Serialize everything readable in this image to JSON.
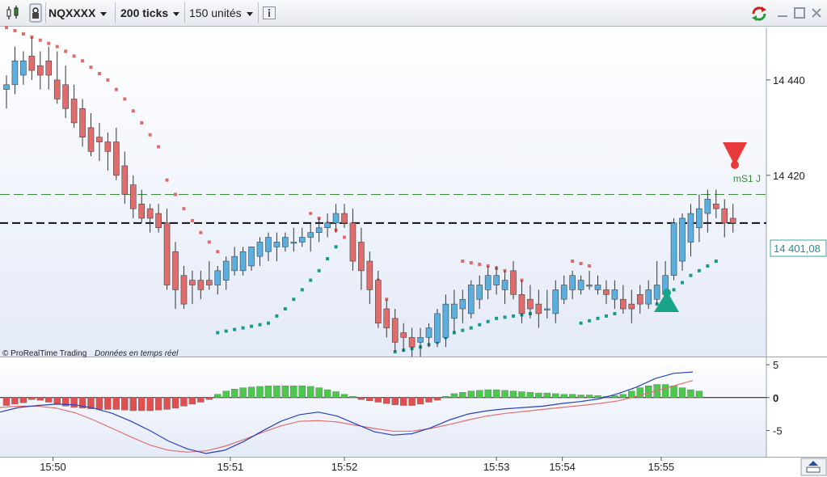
{
  "toolbar": {
    "symbol": "NQXXXX",
    "interval": "200 ticks",
    "units": "150 unités",
    "icons": [
      "candlestick-icon",
      "lock-icon",
      "info-icon",
      "refresh-icon",
      "minimize-icon",
      "maximize-icon",
      "close-icon"
    ]
  },
  "chart": {
    "copyright": "© ProRealTime Trading",
    "realtime": "Données en temps réel",
    "level_label": "mS1 J",
    "last_price": "14 401,08",
    "price_ticks": [
      "14 440",
      "14 420"
    ],
    "osc_ticks": [
      "5",
      "0",
      "-5"
    ],
    "time_ticks": [
      "15:50",
      "15:51",
      "15:52",
      "15:53",
      "15:54",
      "15:55"
    ]
  },
  "colors": {
    "up": "#5aaee0",
    "down": "#e06c6c",
    "sar_red": "#e06c6c",
    "sar_teal": "#1a9a8a",
    "hist_up": "#4cc94c",
    "hist_down": "#e05050",
    "blue_line": "#2a3fbf",
    "red_line": "#e07070",
    "green_level": "#3a8a3a",
    "price_bg": "#eef2fb"
  },
  "chart_data": {
    "type": "candlestick",
    "time_ticks": [
      "15:50",
      "15:51",
      "15:52",
      "15:53",
      "15:54",
      "15:55"
    ],
    "ylim": [
      14382,
      14451
    ],
    "level_mS1J": 14416,
    "pivot_level": 14410,
    "last_price": 14401.08,
    "candles": [
      [
        14438,
        14441,
        14434,
        14439
      ],
      [
        14439,
        14447,
        14437,
        14444
      ],
      [
        14441,
        14446,
        14439,
        14444
      ],
      [
        14445,
        14449,
        14440,
        14442
      ],
      [
        14443,
        14446,
        14438,
        14441
      ],
      [
        14444,
        14447,
        14438,
        14441
      ],
      [
        14440,
        14446,
        14435,
        14436
      ],
      [
        14439,
        14443,
        14432,
        14434
      ],
      [
        14436,
        14439,
        14430,
        14431
      ],
      [
        14434,
        14436,
        14426,
        14428
      ],
      [
        14430,
        14433,
        14424,
        14425
      ],
      [
        14428,
        14431,
        14423,
        14427
      ],
      [
        14427,
        14429,
        14421,
        14425
      ],
      [
        14427,
        14430,
        14419,
        14420
      ],
      [
        14422,
        14425,
        14414,
        14416
      ],
      [
        14418,
        14420,
        14411,
        14413
      ],
      [
        14414,
        14417,
        14410,
        14411
      ],
      [
        14413,
        14414,
        14408,
        14411
      ],
      [
        14412,
        14414,
        14408,
        14409
      ],
      [
        14410,
        14413,
        14396,
        14397
      ],
      [
        14404,
        14406,
        14392,
        14396
      ],
      [
        14399,
        14401,
        14392,
        14393
      ],
      [
        14398,
        14400,
        14393,
        14397
      ],
      [
        14398,
        14400,
        14394,
        14396
      ],
      [
        14398,
        14402,
        14396,
        14397
      ],
      [
        14397,
        14401,
        14395,
        14400
      ],
      [
        14398,
        14403,
        14396,
        14402
      ],
      [
        14400,
        14405,
        14399,
        14403
      ],
      [
        14400,
        14405,
        14399,
        14404
      ],
      [
        14401,
        14405,
        14400,
        14405
      ],
      [
        14403,
        14407,
        14401,
        14406
      ],
      [
        14404,
        14408,
        14402,
        14407
      ],
      [
        14405,
        14408,
        14402,
        14406
      ],
      [
        14405,
        14408,
        14404,
        14407
      ],
      [
        14406,
        14409,
        14404,
        14406
      ],
      [
        14406,
        14409,
        14405,
        14407
      ],
      [
        14407,
        14410,
        14404,
        14408
      ],
      [
        14408,
        14411,
        14406,
        14409
      ],
      [
        14409,
        14412,
        14407,
        14410
      ],
      [
        14410,
        14414,
        14408,
        14412
      ],
      [
        14412,
        14414,
        14409,
        14410
      ],
      [
        14410,
        14413,
        14400,
        14402
      ],
      [
        14406,
        14409,
        14396,
        14400
      ],
      [
        14402,
        14404,
        14393,
        14396
      ],
      [
        14398,
        14400,
        14388,
        14389
      ],
      [
        14392,
        14394,
        14386,
        14388
      ],
      [
        14390,
        14392,
        14383,
        14385
      ],
      [
        14387,
        14389,
        14383,
        14386
      ],
      [
        14386,
        14388,
        14382,
        14384
      ],
      [
        14385,
        14388,
        14382,
        14386
      ],
      [
        14386,
        14389,
        14384,
        14388
      ],
      [
        14385,
        14392,
        14384,
        14391
      ],
      [
        14386,
        14395,
        14384,
        14393
      ],
      [
        14390,
        14396,
        14387,
        14393
      ],
      [
        14392,
        14396,
        14389,
        14394
      ],
      [
        14391,
        14398,
        14390,
        14397
      ],
      [
        14394,
        14399,
        14392,
        14397
      ],
      [
        14396,
        14401,
        14394,
        14399
      ],
      [
        14397,
        14401,
        14395,
        14399
      ],
      [
        14396,
        14400,
        14393,
        14398
      ],
      [
        14400,
        14402,
        14394,
        14395
      ],
      [
        14395,
        14398,
        14389,
        14391
      ],
      [
        14394,
        14397,
        14390,
        14392
      ],
      [
        14393,
        14396,
        14388,
        14391
      ],
      [
        14392,
        14396,
        14390,
        14392
      ],
      [
        14391,
        14398,
        14389,
        14396
      ],
      [
        14394,
        14399,
        14393,
        14397
      ],
      [
        14396,
        14400,
        14394,
        14399
      ],
      [
        14396,
        14399,
        14395,
        14398
      ],
      [
        14397,
        14400,
        14396,
        14397
      ],
      [
        14396,
        14399,
        14395,
        14397
      ],
      [
        14396,
        14398,
        14393,
        14395
      ],
      [
        14394,
        14398,
        14392,
        14396
      ],
      [
        14394,
        14397,
        14391,
        14392
      ],
      [
        14393,
        14396,
        14389,
        14392
      ],
      [
        14395,
        14397,
        14391,
        14393
      ],
      [
        14393,
        14398,
        14392,
        14396
      ],
      [
        14394,
        14402,
        14393,
        14397
      ],
      [
        14395,
        14402,
        14393,
        14399
      ],
      [
        14399,
        14411,
        14398,
        14410
      ],
      [
        14402,
        14412,
        14400,
        14411
      ],
      [
        14406,
        14414,
        14403,
        14412
      ],
      [
        14409,
        14416,
        14406,
        14413
      ],
      [
        14412,
        14417,
        14408,
        14415
      ],
      [
        14414,
        14417,
        14411,
        14413
      ],
      [
        14413,
        14415,
        14407,
        14410
      ],
      [
        14411,
        14414,
        14408,
        14410
      ]
    ],
    "series": [
      {
        "name": "sar_red",
        "points": [
          [
            0,
            14451
          ],
          [
            3,
            14449
          ],
          [
            6,
            14447
          ],
          [
            9,
            14444
          ],
          [
            12,
            14440
          ],
          [
            14,
            14436
          ],
          [
            16,
            14431
          ],
          [
            18,
            14426
          ],
          [
            19,
            14419
          ],
          [
            21,
            14413
          ],
          [
            23,
            14408
          ],
          [
            25,
            14404
          ],
          [
            36,
            14412
          ],
          [
            38,
            14410
          ],
          [
            40,
            14407
          ],
          [
            42,
            14402
          ],
          [
            44,
            14398
          ],
          [
            45,
            14394
          ],
          [
            54,
            14402
          ],
          [
            57,
            14401
          ],
          [
            59,
            14400
          ],
          [
            61,
            14398
          ],
          [
            67,
            14402
          ],
          [
            69,
            14401
          ]
        ]
      },
      {
        "name": "sar_teal",
        "points": [
          [
            25,
            14387
          ],
          [
            28,
            14388
          ],
          [
            31,
            14389
          ],
          [
            33,
            14392
          ],
          [
            35,
            14396
          ],
          [
            37,
            14400
          ],
          [
            39,
            14405
          ],
          [
            46,
            14383
          ],
          [
            49,
            14384
          ],
          [
            51,
            14385
          ],
          [
            53,
            14387
          ],
          [
            55,
            14388
          ],
          [
            58,
            14390
          ],
          [
            62,
            14391
          ],
          [
            68,
            14389
          ],
          [
            70,
            14390
          ],
          [
            72,
            14391
          ],
          [
            77,
            14393
          ],
          [
            79,
            14396
          ],
          [
            81,
            14399
          ],
          [
            84,
            14402
          ]
        ]
      }
    ],
    "oscillator": {
      "ylim": [
        -9,
        6
      ],
      "histogram": [
        -1.2,
        -1.0,
        -0.8,
        -0.3,
        -0.4,
        -0.7,
        -1.0,
        -1.3,
        -1.5,
        -1.6,
        -1.7,
        -1.8,
        -1.8,
        -1.8,
        -1.9,
        -2.0,
        -2.0,
        -2.0,
        -1.9,
        -1.8,
        -1.6,
        -1.3,
        -1.0,
        -0.7,
        -0.3,
        0.5,
        1.0,
        1.3,
        1.5,
        1.6,
        1.7,
        1.8,
        1.8,
        1.8,
        1.8,
        1.8,
        1.7,
        1.5,
        1.2,
        0.9,
        0.5,
        0.2,
        -0.3,
        -0.5,
        -0.7,
        -0.9,
        -1.1,
        -1.2,
        -1.2,
        -1.0,
        -0.7,
        -0.4,
        0.2,
        0.6,
        0.8,
        1.0,
        1.1,
        1.2,
        1.2,
        1.1,
        1.0,
        0.9,
        0.8,
        0.7,
        0.7,
        0.6,
        0.5,
        0.5,
        0.4,
        0.4,
        0.3,
        0.2,
        0.3,
        0.5,
        1.0,
        1.5,
        1.8,
        2.0,
        2.0,
        1.8,
        1.5,
        1.2,
        1.0
      ],
      "blue": [
        -2.2,
        -1.5,
        -1.2,
        -1.0,
        -1.1,
        -1.6,
        -2.4,
        -3.6,
        -5.0,
        -6.6,
        -7.8,
        -8.5,
        -8.0,
        -6.7,
        -5.1,
        -3.6,
        -2.6,
        -2.2,
        -2.8,
        -4.0,
        -5.2,
        -5.7,
        -5.5,
        -4.6,
        -3.4,
        -2.5,
        -2.0,
        -1.7,
        -1.5,
        -1.3,
        -0.9,
        -0.6,
        -0.2,
        0.6,
        1.6,
        2.9,
        3.7,
        3.9
      ],
      "red": [
        -1.5,
        -1.3,
        -1.3,
        -1.6,
        -2.3,
        -3.4,
        -4.7,
        -6.0,
        -7.2,
        -8.0,
        -8.3,
        -8.1,
        -7.4,
        -6.4,
        -5.3,
        -4.3,
        -3.6,
        -3.5,
        -3.7,
        -4.2,
        -4.7,
        -5.1,
        -5.1,
        -4.7,
        -4.1,
        -3.4,
        -2.8,
        -2.4,
        -2.1,
        -1.8,
        -1.5,
        -1.2,
        -0.9,
        -0.5,
        0.2,
        1.0,
        1.8,
        2.6
      ]
    }
  }
}
